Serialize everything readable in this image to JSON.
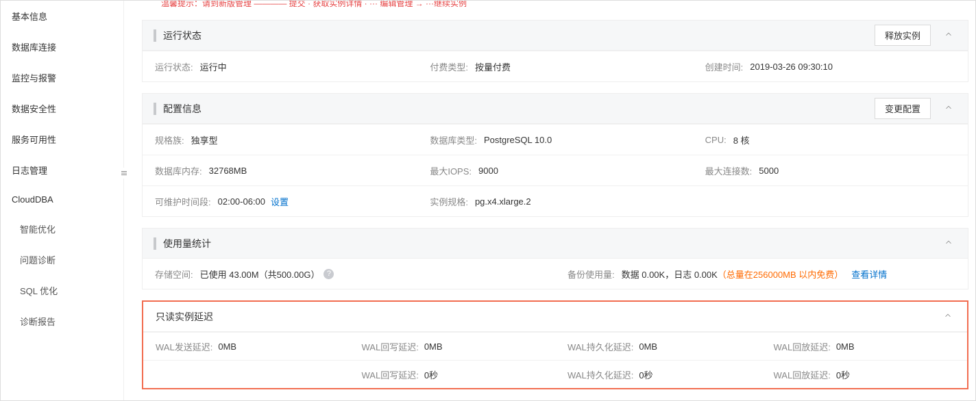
{
  "sidebar": {
    "items": [
      {
        "label": "基本信息"
      },
      {
        "label": "数据库连接"
      },
      {
        "label": "监控与报警"
      },
      {
        "label": "数据安全性"
      },
      {
        "label": "服务可用性"
      },
      {
        "label": "日志管理"
      },
      {
        "label": "CloudDBA"
      },
      {
        "label": "智能优化"
      },
      {
        "label": "问题诊断"
      },
      {
        "label": "SQL 优化"
      },
      {
        "label": "诊断报告"
      }
    ]
  },
  "topBanner": "温馨提示：请到新版管理 ———— 提交 · 获取实例详情 · ···  编辑管理 →  ···继续实例",
  "runStatus": {
    "title": "运行状态",
    "releaseBtn": "释放实例",
    "statusLabel": "运行状态:",
    "statusValue": "运行中",
    "payLabel": "付费类型:",
    "payValue": "按量付费",
    "createdLabel": "创建时间:",
    "createdValue": "2019-03-26 09:30:10"
  },
  "config": {
    "title": "配置信息",
    "changeBtn": "变更配置",
    "specFamilyLabel": "规格族:",
    "specFamilyValue": "独享型",
    "dbTypeLabel": "数据库类型:",
    "dbTypeValue": "PostgreSQL 10.0",
    "cpuLabel": "CPU:",
    "cpuValue": "8 核",
    "memLabel": "数据库内存:",
    "memValue": "32768MB",
    "iopsLabel": "最大IOPS:",
    "iopsValue": "9000",
    "connLabel": "最大连接数:",
    "connValue": "5000",
    "maintLabel": "可维护时间段:",
    "maintValue": "02:00-06:00",
    "maintSet": "设置",
    "instSpecLabel": "实例规格:",
    "instSpecValue": "pg.x4.xlarge.2"
  },
  "usage": {
    "title": "使用量统计",
    "storageLabel": "存储空间:",
    "storageValue": "已使用 43.00M（共500.00G）",
    "backupLabel": "备份使用量:",
    "backupValue": "数据 0.00K，日志 0.00K",
    "backupFree": "（总量在256000MB 以内免费）",
    "detailLink": "查看详情"
  },
  "delay": {
    "title": "只读实例延迟",
    "sendLabel": "WAL发送延迟:",
    "sendValue": "0MB",
    "writeLabel": "WAL回写延迟:",
    "writeMbValue": "0MB",
    "writeSecValue": "0秒",
    "flushLabel": "WAL持久化延迟:",
    "flushMbValue": "0MB",
    "flushSecValue": "0秒",
    "replayLabel": "WAL回放延迟:",
    "replayMbValue": "0MB",
    "replaySecValue": "0秒"
  }
}
